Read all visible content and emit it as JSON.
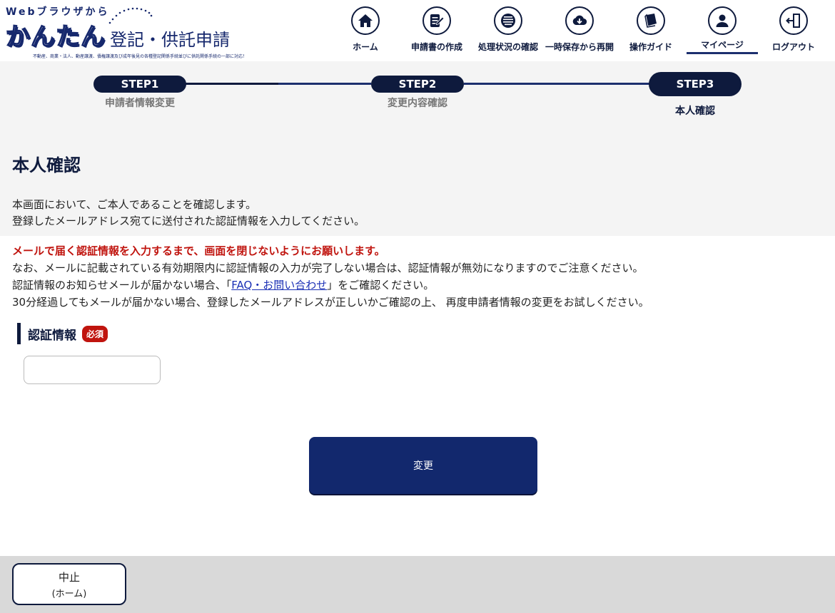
{
  "header": {
    "logo": {
      "web_text": "Webブラウザから",
      "kantan": "かんたん",
      "title": "登記・供託申請",
      "subtitle": "不動産、商業・法人、動産譲渡、債権譲渡及び成年後見の各種登記関係手続並びに供託関係手続の一部に対応！"
    },
    "nav": [
      {
        "label": "ホーム",
        "icon": "home-icon"
      },
      {
        "label": "申請書の作成",
        "icon": "edit-document-icon"
      },
      {
        "label": "処理状況の確認",
        "icon": "status-list-icon"
      },
      {
        "label": "一時保存から再開",
        "icon": "cloud-download-icon"
      },
      {
        "label": "操作ガイド",
        "icon": "guide-book-icon"
      },
      {
        "label": "マイページ",
        "icon": "user-icon",
        "active": true
      },
      {
        "label": "ログアウト",
        "icon": "logout-icon"
      }
    ]
  },
  "steps": [
    {
      "pill": "STEP1",
      "name": "申請者情報変更"
    },
    {
      "pill": "STEP2",
      "name": "変更内容確認"
    },
    {
      "pill": "STEP3",
      "name": "本人確認",
      "current": true
    }
  ],
  "page": {
    "title": "本人確認",
    "intro_line1": "本画面において、ご本人であることを確認します。",
    "intro_line2": "登録したメールアドレス宛てに送付された認証情報を入力してください。"
  },
  "notices": {
    "warning": "メールで届く認証情報を入力するまで、画面を閉じないようにお願いします。",
    "line1": "なお、メールに記載されている有効期限内に認証情報の入力が完了しない場合は、認証情報が無効になりますのでご注意ください。",
    "line2_before": "認証情報のお知らせメールが届かない場合、「",
    "line2_link": "FAQ・お問い合わせ",
    "line2_after": "」をご確認ください。",
    "line3": "30分経過してもメールが届かない場合、登録したメールアドレスが正しいかご確認の上、 再度申請者情報の変更をお試しください。"
  },
  "form": {
    "label": "認証情報",
    "required_badge": "必須",
    "value": "",
    "submit_label": "変更"
  },
  "footer": {
    "cancel_label": "中止",
    "cancel_sub": "(ホーム)"
  },
  "colors": {
    "navy": "#0e1a3d",
    "button_blue": "#12286d",
    "warning_red": "#c0140e",
    "link_blue": "#1a2fb5"
  }
}
